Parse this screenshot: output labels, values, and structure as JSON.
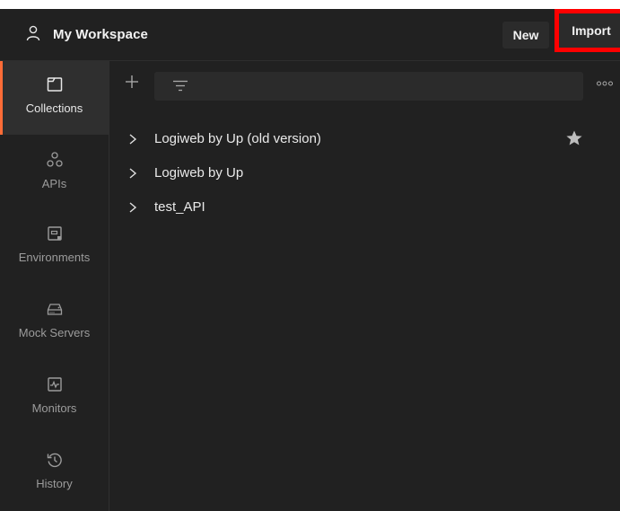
{
  "header": {
    "workspace_title": "My Workspace",
    "new_label": "New",
    "import_label": "Import"
  },
  "sidebar": {
    "items": [
      {
        "label": "Collections",
        "icon": "collections-icon",
        "active": true
      },
      {
        "label": "APIs",
        "icon": "apis-icon",
        "active": false
      },
      {
        "label": "Environments",
        "icon": "environments-icon",
        "active": false
      },
      {
        "label": "Mock Servers",
        "icon": "mock-servers-icon",
        "active": false
      },
      {
        "label": "Monitors",
        "icon": "monitors-icon",
        "active": false
      },
      {
        "label": "History",
        "icon": "history-icon",
        "active": false
      }
    ]
  },
  "collections": [
    {
      "name": "Logiweb by Up (old version)",
      "starred": true
    },
    {
      "name": "Logiweb by Up",
      "starred": false
    },
    {
      "name": "test_API",
      "starred": false
    }
  ],
  "colors": {
    "background": "#212121",
    "active_item": "#2f2f2f",
    "accent": "#ff6c37",
    "highlight_box": "#ff0000"
  }
}
